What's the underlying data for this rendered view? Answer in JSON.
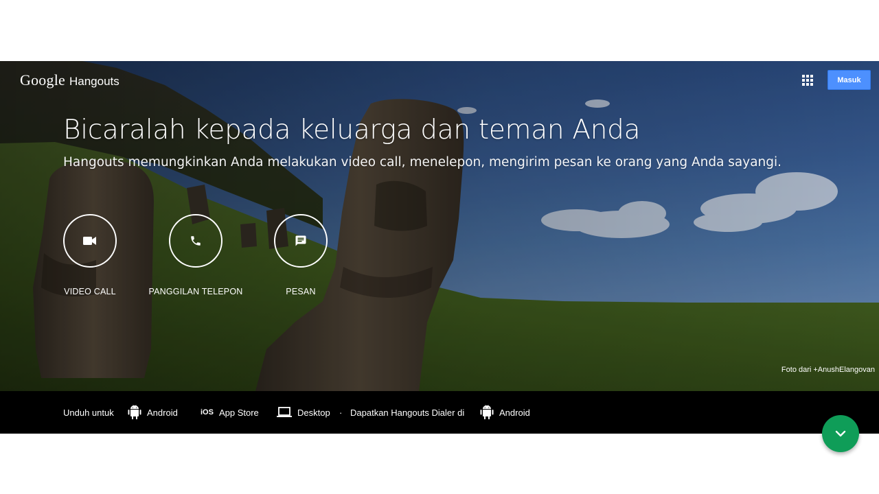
{
  "header": {
    "brand_google": "Google",
    "brand_product": "Hangouts",
    "apps_icon": "apps-grid-icon",
    "signin_label": "Masuk"
  },
  "hero": {
    "headline": "Bicaralah kepada keluarga dan teman Anda",
    "subline": "Hangouts memungkinkan Anda melakukan video call, menelepon, mengirim pesan ke orang yang Anda sayangi.",
    "features": [
      {
        "label": "VIDEO CALL",
        "icon": "videocam-icon"
      },
      {
        "label": "PANGGILAN TELEPON",
        "icon": "phone-icon"
      },
      {
        "label": "PESAN",
        "icon": "message-icon"
      }
    ],
    "photo_credit": "Foto dari +AnushElangovan"
  },
  "download_bar": {
    "prefix": "Unduh untuk",
    "android": "Android",
    "ios_mark": "iOS",
    "app_store": "App Store",
    "desktop": "Desktop",
    "separator": "·",
    "dialer_text": "Dapatkan Hangouts Dialer di",
    "dialer_android": "Android"
  },
  "fab": {
    "icon": "chevron-down-icon"
  },
  "colors": {
    "signin_blue": "#4d90fe",
    "fab_green": "#0f9d58",
    "bar_black": "#000000"
  }
}
